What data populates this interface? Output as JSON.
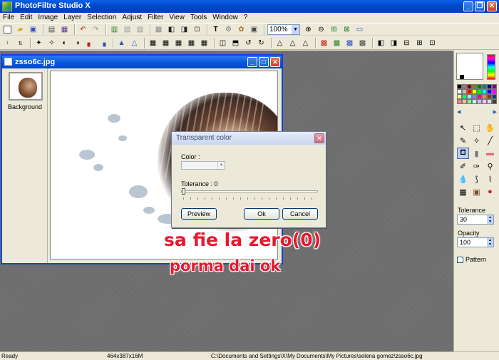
{
  "app": {
    "title": "PhotoFiltre Studio X"
  },
  "menu": [
    "File",
    "Edit",
    "Image",
    "Layer",
    "Selection",
    "Adjust",
    "Filter",
    "View",
    "Tools",
    "Window",
    "?"
  ],
  "toolbar": {
    "zoom": "100%"
  },
  "document": {
    "title": "zsso6c.jpg",
    "layer_label": "Background"
  },
  "palette": {
    "tolerance_label": "Tolerance",
    "tolerance_value": "30",
    "opacity_label": "Opacity",
    "opacity_value": "100",
    "pattern_label": "Pattern",
    "swatch_colors": [
      "#000000",
      "#808080",
      "#800000",
      "#808000",
      "#008000",
      "#008080",
      "#000080",
      "#800080",
      "#ffffff",
      "#c0c0c0",
      "#ff0000",
      "#ffff00",
      "#00ff00",
      "#00ffff",
      "#0000ff",
      "#ff00ff",
      "#ffff80",
      "#00ff80",
      "#80ffff",
      "#8080ff",
      "#ff0080",
      "#ff8040",
      "#804000",
      "#004080",
      "#ff8080",
      "#ffc080",
      "#80ff80",
      "#c0ffff",
      "#c0c0ff",
      "#ffc0ff",
      "#e0e0e0",
      "#404040"
    ]
  },
  "dialog": {
    "title": "Transparent color",
    "color_label": "Color :",
    "tolerance_label": "Tolerance : 0",
    "tolerance_value": 0,
    "preview_label": "Preview",
    "ok_label": "Ok",
    "cancel_label": "Cancel"
  },
  "annotation": {
    "line1": "sa fie la zero(0)",
    "line2": "porma dai ok"
  },
  "status": {
    "state": "Ready",
    "dimensions": "464x387x16M",
    "path": "C:\\Documents and Settings\\X\\My Documents\\My Pictures\\selena gomez\\zsso6c.jpg"
  }
}
